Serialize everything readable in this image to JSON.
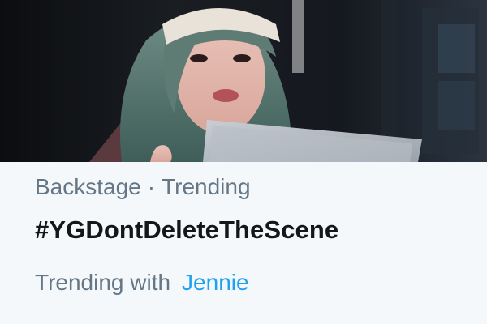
{
  "trend": {
    "category": "Backstage",
    "separator": "·",
    "status": "Trending",
    "hashtag": "#YGDontDeleteTheScene",
    "related_label": "Trending with",
    "related_link": "Jennie"
  },
  "colors": {
    "background": "#f5f8fa",
    "muted_text": "#657786",
    "primary_text": "#14171a",
    "link": "#1da1f2"
  }
}
